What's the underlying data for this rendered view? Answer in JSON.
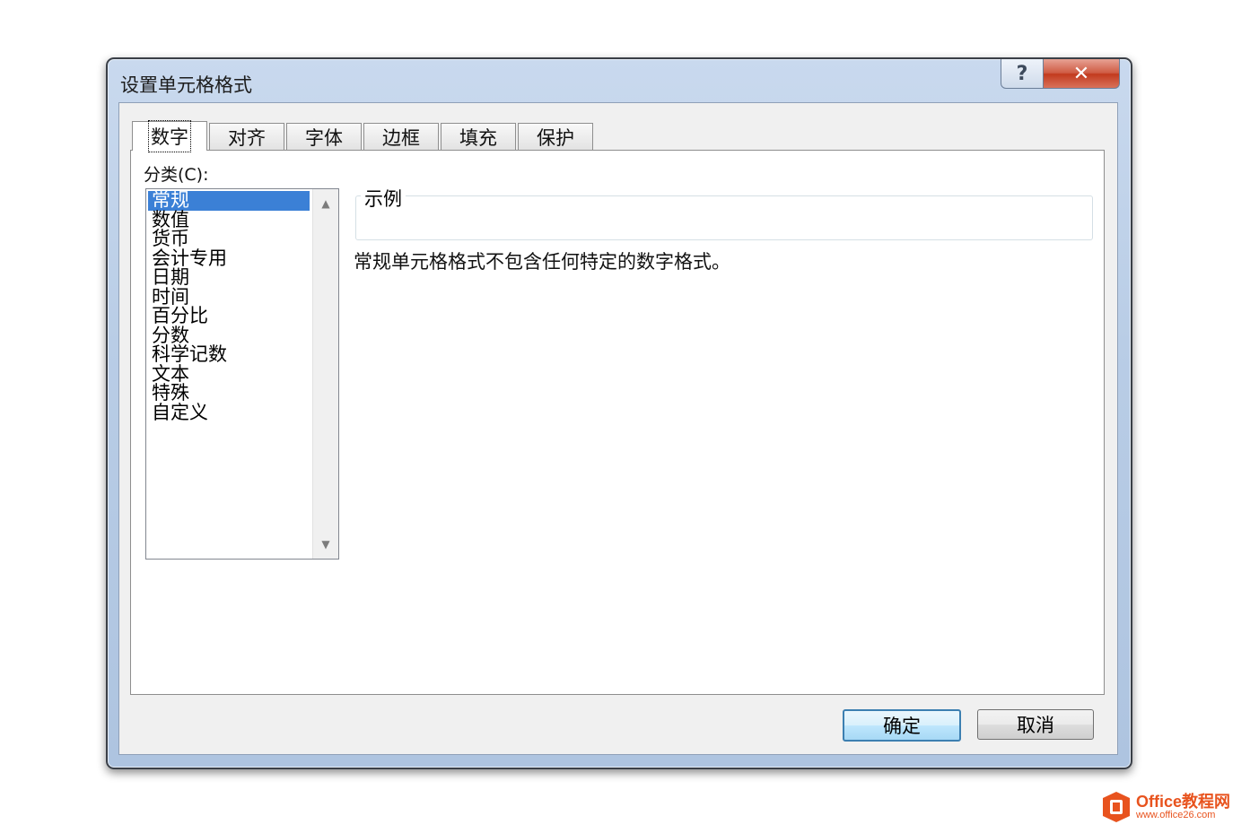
{
  "dialog": {
    "title": "设置单元格格式",
    "help_glyph": "?",
    "close_glyph": "✕"
  },
  "tabs": [
    {
      "label": "数字",
      "active": true
    },
    {
      "label": "对齐",
      "active": false
    },
    {
      "label": "字体",
      "active": false
    },
    {
      "label": "边框",
      "active": false
    },
    {
      "label": "填充",
      "active": false
    },
    {
      "label": "保护",
      "active": false
    }
  ],
  "category": {
    "label": "分类(C):",
    "items": [
      "常规",
      "数值",
      "货币",
      "会计专用",
      "日期",
      "时间",
      "百分比",
      "分数",
      "科学记数",
      "文本",
      "特殊",
      "自定义"
    ],
    "selected_index": 0
  },
  "sample": {
    "legend": "示例",
    "value": ""
  },
  "description": "常规单元格格式不包含任何特定的数字格式。",
  "buttons": {
    "ok": "确定",
    "cancel": "取消"
  },
  "watermark": {
    "title": "Office教程网",
    "url": "www.office26.com"
  },
  "colors": {
    "selection": "#3b80d6",
    "watermark": "#e8531e",
    "close_button": "#c23a1e"
  }
}
